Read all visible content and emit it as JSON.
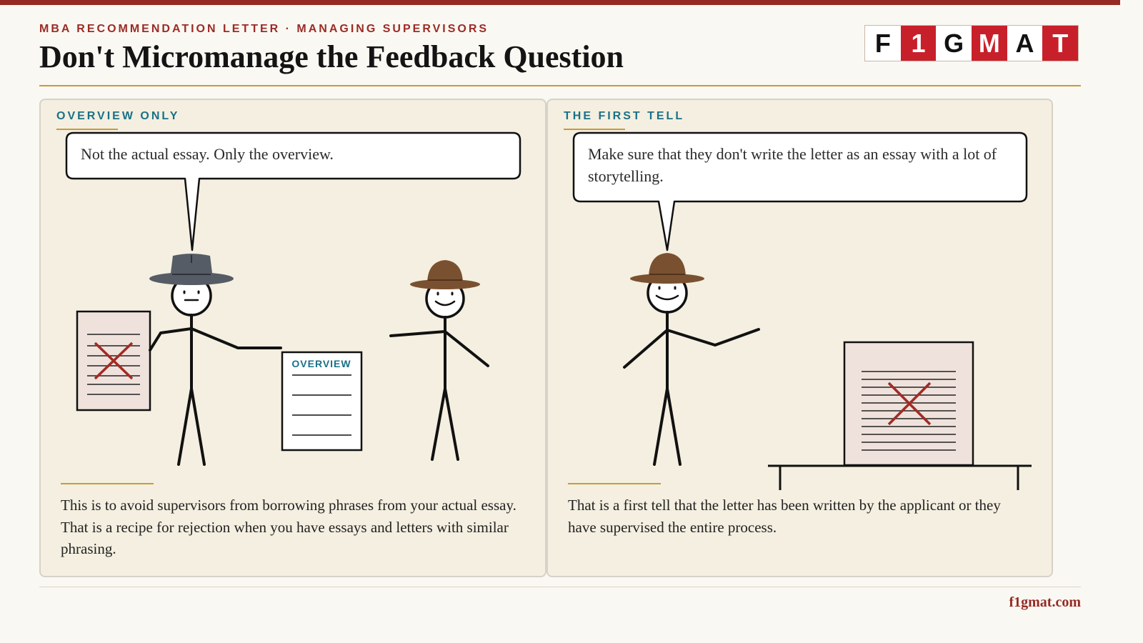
{
  "header": {
    "kicker": "MBA RECOMMENDATION LETTER · MANAGING SUPERVISORS",
    "title": "Don't Micromanage the Feedback Question",
    "logo_letters": [
      {
        "char": "F",
        "color": "#111111",
        "bg": "#ffffff"
      },
      {
        "char": "1",
        "color": "#ffffff",
        "bg": "#c8202a"
      },
      {
        "char": "G",
        "color": "#111111",
        "bg": "#ffffff"
      },
      {
        "char": "M",
        "color": "#ffffff",
        "bg": "#c8202a"
      },
      {
        "char": "A",
        "color": "#111111",
        "bg": "#ffffff"
      },
      {
        "char": "T",
        "color": "#ffffff",
        "bg": "#c8202a"
      }
    ]
  },
  "panels": [
    {
      "label": "OVERVIEW ONLY",
      "bubble": "Not the actual essay. Only the overview.",
      "doc_label": "OVERVIEW",
      "body": "This is to avoid supervisors from borrowing phrases from your actual essay. That is a recipe for rejection when you have essays and letters with similar phrasing."
    },
    {
      "label": "THE FIRST TELL",
      "bubble": "Make sure that they don't write the letter as an essay with a lot of storytelling.",
      "body": "That is a first tell that the letter has been written by the applicant or they have supervised the entire process."
    }
  ],
  "footer": {
    "site": "f1gmat.com"
  },
  "colors": {
    "brand_red": "#952a24",
    "accent_teal": "#1a7188",
    "accent_gold": "#c99a3c",
    "panel_bg": "#f4efe0",
    "hat_gray": "#555c66",
    "hat_brown": "#7a5130",
    "reject_red": "#a32a24"
  },
  "icons": [
    "rejected-essay-icon",
    "overview-document-icon",
    "fedora-hat-icon",
    "ranger-hat-icon",
    "table-icon"
  ]
}
